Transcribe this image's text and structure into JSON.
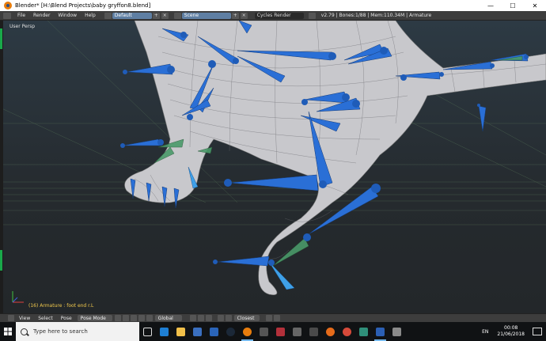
{
  "window": {
    "title": "Blender* [H:\\Blend Projects\\baby gryffon8.blend]",
    "minimize_glyph": "—",
    "maximize_glyph": "☐",
    "close_glyph": "✕"
  },
  "info_header": {
    "menus": [
      "File",
      "Render",
      "Window",
      "Help"
    ],
    "screen_layout": "Default",
    "scene": "Scene",
    "render_engine": "Cycles Render",
    "stats": "v2.79 | Bones:1/88 | Mem:110.34M | Armature",
    "add_glyph": "+",
    "remove_glyph": "×"
  },
  "viewport": {
    "view_label": "User Persp",
    "status_text": "(16) Armature : foot end r.L"
  },
  "view_header": {
    "menus": [
      "View",
      "Select",
      "Pose"
    ],
    "mode": "Pose Mode",
    "orientation": "Global",
    "snap_target": "Closest"
  },
  "taskbar": {
    "search_placeholder": "Type here to search",
    "language": "EN",
    "time": "00:08",
    "date": "21/06/2018"
  },
  "colors": {
    "bone": "#2a6fd6",
    "bone_selected": "#3fa0e8",
    "bone_active": "#4a9a6a",
    "mesh": "#c8c8cc",
    "accent": "#5f7fa3"
  }
}
